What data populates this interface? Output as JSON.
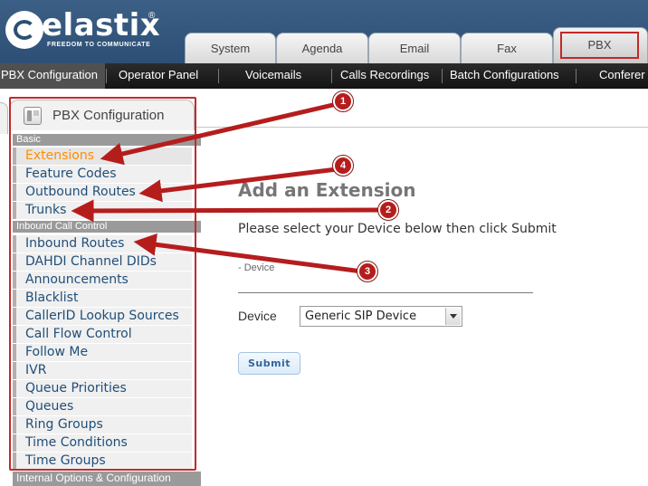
{
  "header": {
    "brand": "elastix",
    "brand_reg": "®",
    "tagline": "FREEDOM TO COMMUNICATE",
    "tabs": [
      "System",
      "Agenda",
      "Email",
      "Fax",
      "PBX"
    ]
  },
  "menubar": {
    "items": [
      "PBX Configuration",
      "Operator Panel",
      "Voicemails",
      "Calls Recordings",
      "Batch Configurations",
      "Conferer"
    ]
  },
  "panel": {
    "title": "PBX Configuration"
  },
  "sidebar": {
    "sections": [
      {
        "header": "Basic",
        "items": [
          "Extensions",
          "Feature Codes",
          "Outbound Routes",
          "Trunks"
        ]
      },
      {
        "header": "Inbound Call Control",
        "items": [
          "Inbound Routes",
          "DAHDI Channel DIDs",
          "Announcements",
          "Blacklist",
          "CallerID Lookup Sources",
          "Call Flow Control",
          "Follow Me",
          "IVR",
          "Queue Priorities",
          "Queues",
          "Ring Groups",
          "Time Conditions",
          "Time Groups"
        ]
      },
      {
        "header": "Internal Options & Configuration",
        "items": []
      }
    ]
  },
  "main": {
    "title": "Add an Extension",
    "instruction": "Please select your Device below then click Submit",
    "device_caption": "- Device",
    "device_label": "Device",
    "device_selected": "Generic SIP Device",
    "submit_label": "Submit"
  },
  "annotations": {
    "markers": [
      "1",
      "2",
      "3",
      "4"
    ],
    "color": "#b51d1d"
  },
  "colors": {
    "header_blue": "#2d4f75",
    "menubar": "#141414",
    "active_link": "#ff8c00",
    "link": "#1f4e79",
    "highlight_red": "#c22a2a"
  }
}
